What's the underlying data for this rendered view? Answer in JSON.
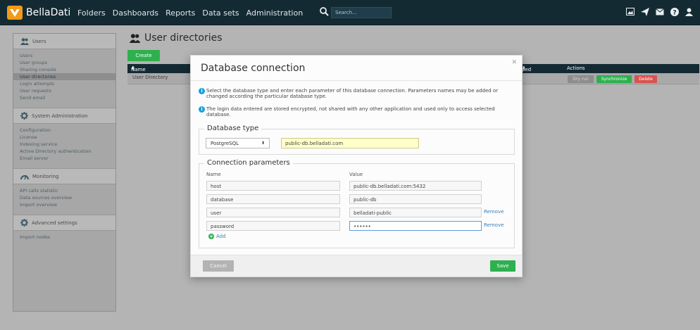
{
  "app": {
    "name": "BellaDati"
  },
  "nav": [
    "Folders",
    "Dashboards",
    "Reports",
    "Data sets",
    "Administration"
  ],
  "search": {
    "placeholder": "Search..."
  },
  "top_icons": [
    "image-icon",
    "send-icon",
    "mail-icon",
    "help-icon",
    "user-icon"
  ],
  "sidebar": {
    "users": {
      "title": "Users",
      "items": [
        "Users",
        "User groups",
        "Sharing console",
        "User directories",
        "Login attempts",
        "User requests",
        "Send email"
      ],
      "active": "User directories"
    },
    "system": {
      "title": "System Administration",
      "items": [
        "Configuration",
        "License",
        "Indexing service",
        "Active Directory authentication",
        "Email server"
      ]
    },
    "monitoring": {
      "title": "Monitoring",
      "items": [
        "API calls statistic",
        "Data sources overview",
        "Import overview"
      ]
    },
    "advanced": {
      "title": "Advanced settings",
      "items": [
        "Import nodes"
      ]
    }
  },
  "page": {
    "title": "User directories",
    "create_label": "Create",
    "table": {
      "col_name": "Name",
      "col_sync": "ped",
      "col_actions": "Actions",
      "row_name": "User Directory",
      "dry_run": "Dry run",
      "synchronize": "Synchronize",
      "delete": "Delete"
    }
  },
  "modal": {
    "title": "Database connection",
    "info1": "Select the database type and enter each parameter of this database connection. Parameters names may be added or changed according the particular database type.",
    "info2": "The login data entered are stored encrypted, not shared with any other application and used only to access selected database.",
    "db_type_legend": "Database type",
    "db_type": "PostgreSQL",
    "db_url": "public-db.belladati.com",
    "conn_legend": "Connection parameters",
    "name_header": "Name",
    "value_header": "Value",
    "params": [
      {
        "name": "host",
        "value": "public-db.belladati.com:5432",
        "remove": ""
      },
      {
        "name": "database",
        "value": "public-db",
        "remove": ""
      },
      {
        "name": "user",
        "value": "belladati-public",
        "remove": "Remove"
      },
      {
        "name": "password",
        "value": "••••••",
        "remove": "Remove"
      }
    ],
    "add_label": "Add",
    "cancel_label": "Cancel",
    "save_label": "Save"
  },
  "colors": {
    "topbar": "#142a33",
    "accent_green": "#2eb04f",
    "delete_red": "#d9534f",
    "info_blue": "#1aa0d8"
  }
}
